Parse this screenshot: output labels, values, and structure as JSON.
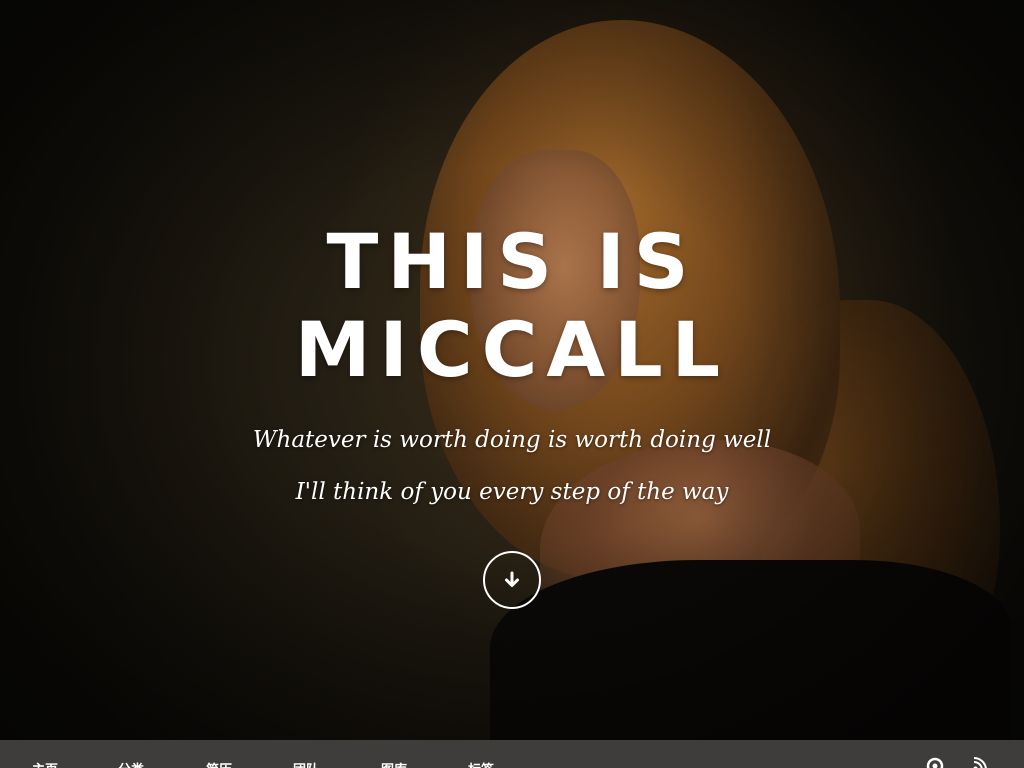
{
  "hero": {
    "title": "THIS IS MICCALL",
    "subtitle_1": "Whatever is worth doing is worth doing well",
    "subtitle_2": "I'll think of you every step of the way",
    "scroll_icon": "arrow-down-circle-icon"
  },
  "navbar": {
    "items": [
      {
        "label": "主页"
      },
      {
        "label": "分类"
      },
      {
        "label": "简历"
      },
      {
        "label": "团队"
      },
      {
        "label": "图库"
      },
      {
        "label": "标签"
      }
    ],
    "icons": [
      "github-icon",
      "rss-icon"
    ]
  },
  "colors": {
    "navbar_bg": "#3e3d3b",
    "text": "#ffffff",
    "hero_bg": "#1a160e"
  }
}
